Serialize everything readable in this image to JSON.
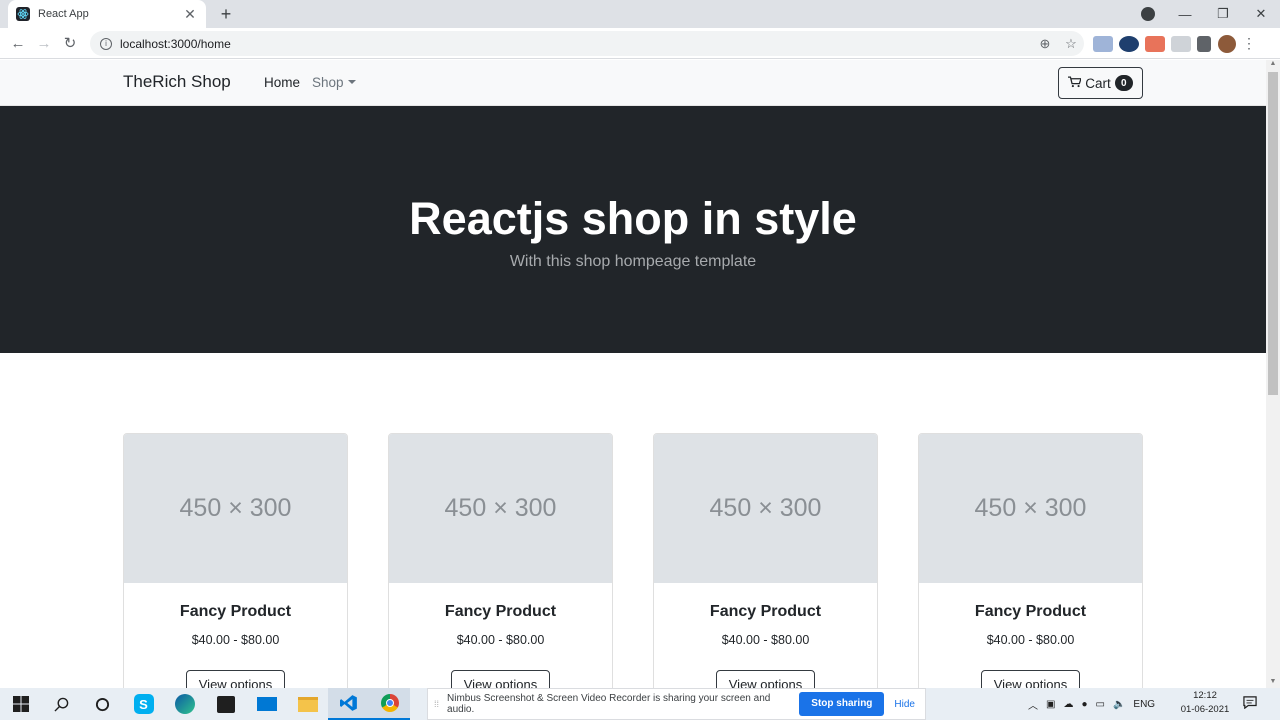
{
  "browser": {
    "tab_title": "React App",
    "tab_close": "✕",
    "new_tab": "+",
    "url": "localhost:3000/home",
    "window_buttons": [
      "—",
      "❐",
      "✕"
    ]
  },
  "navbar": {
    "brand": "TheRich Shop",
    "home": "Home",
    "shop": "Shop",
    "cart_label": "Cart",
    "cart_count": "0"
  },
  "hero": {
    "title": "Reactjs shop in style",
    "subtitle": "With this shop hompeage template"
  },
  "products": [
    {
      "image_label": "450 × 300",
      "name": "Fancy Product",
      "price": "$40.00 - $80.00",
      "button": "View options"
    },
    {
      "image_label": "450 × 300",
      "name": "Fancy Product",
      "price": "$40.00 - $80.00",
      "button": "View options"
    },
    {
      "image_label": "450 × 300",
      "name": "Fancy Product",
      "price": "$40.00 - $80.00",
      "button": "View options"
    },
    {
      "image_label": "450 × 300",
      "name": "Fancy Product",
      "price": "$40.00 - $80.00",
      "button": "View options"
    }
  ],
  "sharing_bar": {
    "message": "Nimbus Screenshot & Screen Video Recorder is sharing your screen and audio.",
    "stop": "Stop sharing",
    "hide": "Hide"
  },
  "taskbar": {
    "lang": "ENG",
    "time": "12:12",
    "date": "01-06-2021"
  },
  "colors": {
    "hero_bg": "#212529",
    "navbar_bg": "#f8f9fa",
    "placeholder_bg": "#dee2e6",
    "share_button": "#1a73e8"
  }
}
